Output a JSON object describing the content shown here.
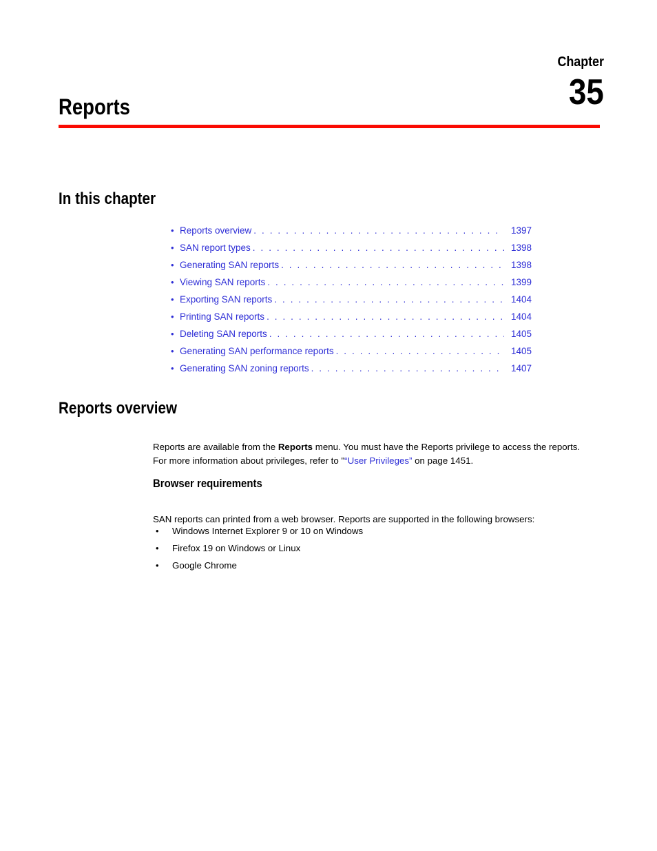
{
  "header": {
    "chapter_word": "Chapter",
    "chapter_number": "35",
    "chapter_title": "Reports",
    "rule_color": "#FA0A02"
  },
  "link_color": "#2D2DD6",
  "in_this_chapter": {
    "heading": "In this chapter",
    "entries": [
      {
        "label": "Reports overview",
        "page": "1397"
      },
      {
        "label": "SAN report types",
        "page": "1398"
      },
      {
        "label": "Generating SAN reports",
        "page": "1398"
      },
      {
        "label": "Viewing SAN reports",
        "page": "1399"
      },
      {
        "label": "Exporting SAN reports",
        "page": "1404"
      },
      {
        "label": "Printing SAN reports",
        "page": "1404"
      },
      {
        "label": "Deleting SAN reports",
        "page": "1405"
      },
      {
        "label": "Generating SAN performance reports",
        "page": "1405"
      },
      {
        "label": "Generating SAN zoning reports",
        "page": "1407"
      }
    ],
    "bullet_glyph": "•",
    "leader_dots": ". . . . . . . . . . . . . . . . . . . . . . . . . . . . . . . . . . . . . . . . . . . . . . . . . . . . . . . . . . . . . . . ."
  },
  "reports_overview": {
    "heading": "Reports overview",
    "paragraph_part1": "Reports are available from the ",
    "paragraph_bold": "Reports",
    "paragraph_part2": " menu. You must have the Reports privilege to access the reports. For more information about privileges, refer to \"",
    "paragraph_link": "“User Privileges”",
    "paragraph_part3": " on page 1451."
  },
  "browser_requirements": {
    "heading": "Browser requirements",
    "intro": "SAN reports can printed from a web browser. Reports are supported in the following browsers:",
    "bullet_glyph": "•",
    "items": [
      "Windows Internet Explorer 9 or 10 on Windows",
      "Firefox 19 on Windows or Linux",
      "Google Chrome"
    ]
  }
}
